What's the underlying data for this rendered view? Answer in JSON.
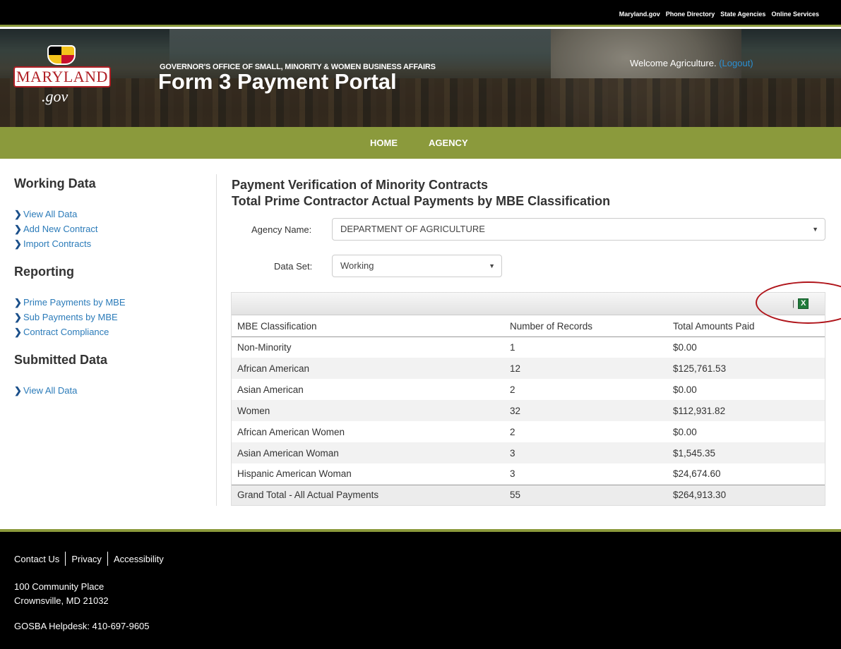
{
  "top_links": [
    "Maryland.gov",
    "Phone Directory",
    "State Agencies",
    "Online Services"
  ],
  "header": {
    "logo_text": "MARYLAND",
    "logo_gov": ".gov",
    "office": "GOVERNOR'S OFFICE OF SMALL, MINORITY & WOMEN BUSINESS AFFAIRS",
    "portal_title": "Form 3 Payment Portal",
    "welcome": "Welcome Agriculture.",
    "logout": "(Logout)"
  },
  "nav": {
    "home": "HOME",
    "agency": "AGENCY"
  },
  "sidebar": {
    "working_title": "Working Data",
    "working_items": [
      "View All Data",
      "Add New Contract",
      "Import Contracts"
    ],
    "reporting_title": "Reporting",
    "reporting_items": [
      "Prime Payments by MBE",
      "Sub Payments by MBE",
      "Contract Compliance"
    ],
    "submitted_title": "Submitted Data",
    "submitted_items": [
      "View All Data"
    ]
  },
  "main": {
    "title_line1": "Payment Verification of Minority Contracts",
    "title_line2": "Total Prime Contractor Actual Payments by MBE Classification",
    "agency_label": "Agency Name:",
    "agency_value": "DEPARTMENT OF AGRICULTURE",
    "dataset_label": "Data Set:",
    "dataset_value": "Working"
  },
  "table": {
    "toolbar_separator": "|",
    "headers": [
      "MBE Classification",
      "Number of Records",
      "Total Amounts Paid"
    ],
    "rows": [
      [
        "Non-Minority",
        "1",
        "$0.00"
      ],
      [
        "African American",
        "12",
        "$125,761.53"
      ],
      [
        "Asian American",
        "2",
        "$0.00"
      ],
      [
        "Women",
        "32",
        "$112,931.82"
      ],
      [
        "African American Women",
        "2",
        "$0.00"
      ],
      [
        "Asian American Woman",
        "3",
        "$1,545.35"
      ],
      [
        "Hispanic American Woman",
        "3",
        "$24,674.60"
      ]
    ],
    "total": [
      "Grand Total - All Actual Payments",
      "55",
      "$264,913.30"
    ]
  },
  "footer": {
    "links": [
      "Contact Us",
      "Privacy",
      "Accessibility"
    ],
    "address1": "100 Community Place",
    "address2": "Crownsville, MD 21032",
    "helpdesk": "GOSBA Helpdesk: 410-697-9605"
  },
  "colors": {
    "accent_green": "#8b9a3c",
    "link_blue": "#2b7bb9",
    "annotation_red": "#b0151b"
  },
  "icons": {
    "export": "excel-export-icon",
    "nav_bullet": "chevron-right-icon",
    "dropdown": "caret-down-icon"
  }
}
